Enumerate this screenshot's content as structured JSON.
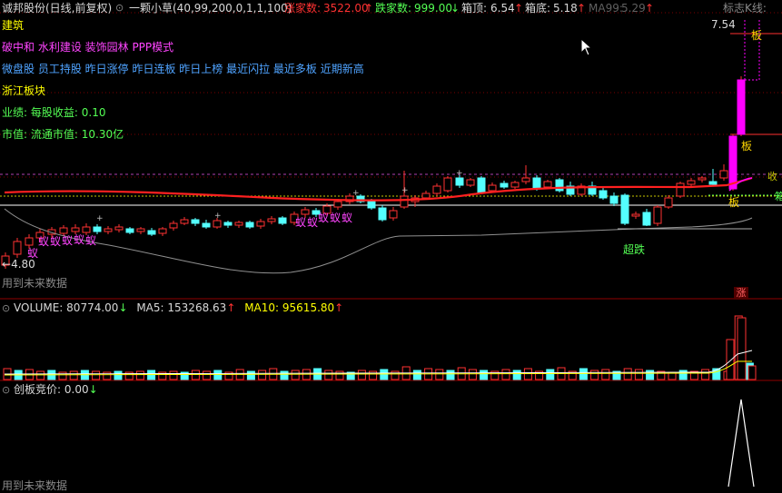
{
  "header": {
    "stock": "诚邦股份(日线,前复权)",
    "formula_icon": "circle-down-icon",
    "formula": "一颗小草(40,99,200,0,1,1,100)",
    "up_count_label": "涨家数:",
    "up_count": "3522.00",
    "down_count_label": "跌家数:",
    "down_count": "999.00",
    "box_top_label": "箱顶:",
    "box_top": "6.54",
    "box_bottom_label": "箱底:",
    "box_bottom": "5.18",
    "ma99_label": "MA99:",
    "ma99": "5.29",
    "kline_label": "标志K线:"
  },
  "info": {
    "industry": "建筑",
    "concepts1": "破中和 水利建设 装饰园林 PPP模式",
    "concepts2": "微盘股 员工持股 昨日涨停 昨日连板 昨日上榜 最近闪拉 最近多板 近期新高",
    "region": "浙江板块",
    "eps_label": "业绩:",
    "eps_name": "每股收益:",
    "eps": "0.10",
    "mcap_label": "市值:",
    "mcap_name": "流通市值:",
    "mcap": "10.30亿"
  },
  "price_labels": {
    "high": "7.54",
    "low": "4.80",
    "low_arrow": "←",
    "future": "用到未来数据",
    "board1": "板",
    "board2": "板",
    "board3": "板",
    "super_fall": "超跌",
    "rise_tag": "涨",
    "ant": "蚁",
    "right_edge1": "收",
    "right_edge2": "箱"
  },
  "volume": {
    "title_icon": "circle-down-icon",
    "label": "VOLUME:",
    "value": "80774.00",
    "ma5_label": "MA5:",
    "ma5": "153268.63",
    "ma10_label": "MA10:",
    "ma10": "95615.80"
  },
  "auction": {
    "title_icon": "circle-down-icon",
    "label": "创板竞价:",
    "value": "0.00",
    "future": "用到未来数据"
  },
  "colors": {
    "up": "#ff3232",
    "down": "#54ffff",
    "ma_line": "#ff2020",
    "limit": "#ff00ff",
    "bg": "#000000"
  }
}
